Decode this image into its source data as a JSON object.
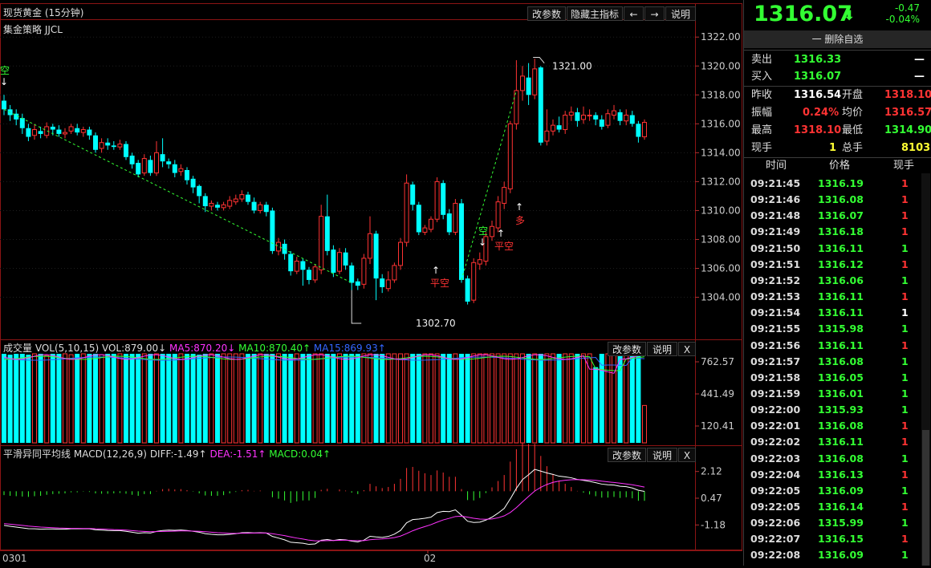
{
  "main_chart": {
    "title": "现货黄金 (15分钟)",
    "strategy": "集金策略 JJCL",
    "buttons": [
      "改参数",
      "隐藏主指标",
      "←",
      "→",
      "说明"
    ],
    "price_axis": [
      "1322.00",
      "1320.00",
      "1318.00",
      "1316.00",
      "1314.00",
      "1312.00",
      "1310.00",
      "1308.00",
      "1306.00",
      "1304.00"
    ],
    "high_label": "1321.00",
    "low_label": "1302.70",
    "signals": {
      "short1": "空",
      "short2": "空",
      "long": "多",
      "flat_short1": "平空",
      "flat_short2": "平空"
    },
    "colors": {
      "up": "#ff3333",
      "down": "#00ffff",
      "trend": "#33ff33",
      "grid": "#1e1e1e",
      "border": "#8b1414"
    }
  },
  "volume_panel": {
    "name": "成交量",
    "params": "VOL(5,10,15)",
    "vol": "VOL:879.00↓",
    "ma5": "MA5:870.20↓",
    "ma10": "MA10:870.40↑",
    "ma15": "MA15:869.93↑",
    "buttons": [
      "改参数",
      "说明",
      "X"
    ],
    "axis": [
      "762.57",
      "441.49",
      "120.41"
    ]
  },
  "macd_panel": {
    "name": "平滑异同平均线",
    "params": "MACD(12,26,9)",
    "diff": "DIFF:-1.49↑",
    "dea": "DEA:-1.51↑",
    "macd": "MACD:0.04↑",
    "buttons": [
      "改参数",
      "说明",
      "X"
    ],
    "axis": [
      "2.12",
      "0.47",
      "-1.18"
    ]
  },
  "date_axis": [
    "0301",
    "02"
  ],
  "quote": {
    "price": "1316.07",
    "change": "-0.47",
    "change_pct": "-0.04%",
    "remove_label": "一 删除自选",
    "sell_label": "卖出",
    "sell": "1316.33",
    "sell_qty": "—",
    "buy_label": "买入",
    "buy": "1316.07",
    "buy_qty": "—",
    "prev_close_label": "昨收",
    "prev_close": "1316.54",
    "open_label": "开盘",
    "open": "1318.10",
    "amplitude_label": "振幅",
    "amplitude": "0.24%",
    "avg_label": "均价",
    "avg": "1316.57",
    "high_label": "最高",
    "high": "1318.10",
    "low_label": "最低",
    "low": "1314.90",
    "cur_qty_label": "现手",
    "cur_qty": "1",
    "total_qty_label": "总手",
    "total_qty": "8103"
  },
  "ticks": {
    "headers": [
      "时间",
      "价格",
      "现手"
    ],
    "rows": [
      {
        "time": "09:21:45",
        "price": "1316.19",
        "qty": "1",
        "qty_color": "#ff3333"
      },
      {
        "time": "09:21:46",
        "price": "1316.08",
        "qty": "1",
        "qty_color": "#ff3333"
      },
      {
        "time": "09:21:48",
        "price": "1316.07",
        "qty": "1",
        "qty_color": "#ff3333"
      },
      {
        "time": "09:21:49",
        "price": "1316.18",
        "qty": "1",
        "qty_color": "#ff3333"
      },
      {
        "time": "09:21:50",
        "price": "1316.11",
        "qty": "1",
        "qty_color": "#33ff33"
      },
      {
        "time": "09:21:51",
        "price": "1316.12",
        "qty": "1",
        "qty_color": "#ff3333"
      },
      {
        "time": "09:21:52",
        "price": "1316.06",
        "qty": "1",
        "qty_color": "#33ff33"
      },
      {
        "time": "09:21:53",
        "price": "1316.11",
        "qty": "1",
        "qty_color": "#ff3333"
      },
      {
        "time": "09:21:54",
        "price": "1316.11",
        "qty": "1",
        "qty_color": "#ffffff"
      },
      {
        "time": "09:21:55",
        "price": "1315.98",
        "qty": "1",
        "qty_color": "#33ff33"
      },
      {
        "time": "09:21:56",
        "price": "1316.11",
        "qty": "1",
        "qty_color": "#ff3333"
      },
      {
        "time": "09:21:57",
        "price": "1316.08",
        "qty": "1",
        "qty_color": "#33ff33"
      },
      {
        "time": "09:21:58",
        "price": "1316.05",
        "qty": "1",
        "qty_color": "#33ff33"
      },
      {
        "time": "09:21:59",
        "price": "1316.01",
        "qty": "1",
        "qty_color": "#33ff33"
      },
      {
        "time": "09:22:00",
        "price": "1315.93",
        "qty": "1",
        "qty_color": "#33ff33"
      },
      {
        "time": "09:22:01",
        "price": "1316.08",
        "qty": "1",
        "qty_color": "#ff3333"
      },
      {
        "time": "09:22:02",
        "price": "1316.11",
        "qty": "1",
        "qty_color": "#ff3333"
      },
      {
        "time": "09:22:03",
        "price": "1316.08",
        "qty": "1",
        "qty_color": "#33ff33"
      },
      {
        "time": "09:22:04",
        "price": "1316.13",
        "qty": "1",
        "qty_color": "#ff3333"
      },
      {
        "time": "09:22:05",
        "price": "1316.09",
        "qty": "1",
        "qty_color": "#33ff33"
      },
      {
        "time": "09:22:05",
        "price": "1316.14",
        "qty": "1",
        "qty_color": "#ff3333"
      },
      {
        "time": "09:22:06",
        "price": "1315.99",
        "qty": "1",
        "qty_color": "#33ff33"
      },
      {
        "time": "09:22:07",
        "price": "1316.15",
        "qty": "1",
        "qty_color": "#ff3333"
      },
      {
        "time": "09:22:08",
        "price": "1316.09",
        "qty": "1",
        "qty_color": "#33ff33"
      }
    ]
  },
  "candles": [
    [
      1317.6,
      1317.0,
      1318.0,
      1316.6
    ],
    [
      1317.0,
      1316.6,
      1317.3,
      1316.2
    ],
    [
      1316.7,
      1316.3,
      1317.0,
      1315.9
    ],
    [
      1316.4,
      1315.7,
      1316.7,
      1315.3
    ],
    [
      1315.7,
      1315.1,
      1316.0,
      1314.8
    ],
    [
      1315.2,
      1315.6,
      1316.0,
      1314.9
    ],
    [
      1315.5,
      1315.3,
      1315.8,
      1315.0
    ],
    [
      1315.2,
      1315.8,
      1316.1,
      1315.0
    ],
    [
      1315.8,
      1315.6,
      1316.0,
      1315.2
    ],
    [
      1315.6,
      1315.3,
      1315.9,
      1315.1
    ],
    [
      1315.3,
      1315.4,
      1315.7,
      1315.0
    ],
    [
      1315.5,
      1315.8,
      1316.0,
      1315.3
    ],
    [
      1315.7,
      1315.4,
      1316.0,
      1315.2
    ],
    [
      1315.4,
      1315.6,
      1315.8,
      1315.1
    ],
    [
      1315.6,
      1315.2,
      1315.8,
      1314.9
    ],
    [
      1315.2,
      1314.2,
      1315.4,
      1314.0
    ],
    [
      1314.3,
      1314.7,
      1315.0,
      1314.0
    ],
    [
      1314.7,
      1314.5,
      1315.0,
      1314.2
    ],
    [
      1314.5,
      1314.4,
      1314.8,
      1314.2
    ],
    [
      1314.4,
      1314.6,
      1314.9,
      1314.2
    ],
    [
      1314.6,
      1313.7,
      1314.8,
      1313.5
    ],
    [
      1313.8,
      1313.2,
      1314.0,
      1312.9
    ],
    [
      1313.3,
      1312.5,
      1313.5,
      1312.3
    ],
    [
      1312.6,
      1313.6,
      1313.9,
      1312.4
    ],
    [
      1313.5,
      1312.6,
      1313.8,
      1312.4
    ],
    [
      1312.6,
      1314.0,
      1314.8,
      1312.4
    ],
    [
      1313.9,
      1313.4,
      1315.0,
      1313.0
    ],
    [
      1313.4,
      1313.2,
      1313.6,
      1312.9
    ],
    [
      1313.2,
      1312.6,
      1313.5,
      1312.3
    ],
    [
      1312.7,
      1312.9,
      1313.2,
      1312.4
    ],
    [
      1312.8,
      1312.1,
      1313.0,
      1311.8
    ],
    [
      1312.2,
      1311.6,
      1312.4,
      1311.2
    ],
    [
      1311.7,
      1311.0,
      1311.8,
      1310.5
    ],
    [
      1311.0,
      1310.3,
      1311.2,
      1309.9
    ],
    [
      1310.3,
      1310.5,
      1310.7,
      1310.0
    ],
    [
      1310.4,
      1310.2,
      1310.6,
      1310.0
    ],
    [
      1310.2,
      1310.4,
      1310.6,
      1310.0
    ],
    [
      1310.3,
      1310.7,
      1311.0,
      1310.1
    ],
    [
      1310.6,
      1310.8,
      1311.1,
      1310.4
    ],
    [
      1310.8,
      1311.1,
      1311.4,
      1310.6
    ],
    [
      1311.1,
      1310.6,
      1311.3,
      1310.4
    ],
    [
      1310.6,
      1310.0,
      1310.9,
      1309.8
    ],
    [
      1310.0,
      1310.4,
      1310.6,
      1309.8
    ],
    [
      1310.4,
      1309.9,
      1310.6,
      1309.6
    ],
    [
      1310.0,
      1307.2,
      1310.2,
      1307.0
    ],
    [
      1307.2,
      1307.8,
      1308.1,
      1306.9
    ],
    [
      1307.7,
      1307.0,
      1308.0,
      1306.6
    ],
    [
      1307.0,
      1305.8,
      1307.2,
      1305.5
    ],
    [
      1305.8,
      1306.5,
      1306.8,
      1305.6
    ],
    [
      1306.5,
      1305.9,
      1306.7,
      1304.8
    ],
    [
      1305.9,
      1305.2,
      1306.1,
      1304.9
    ],
    [
      1305.2,
      1306.1,
      1306.3,
      1305.0
    ],
    [
      1305.9,
      1309.6,
      1310.4,
      1305.6
    ],
    [
      1309.6,
      1307.2,
      1311.1,
      1306.9
    ],
    [
      1307.3,
      1305.7,
      1307.6,
      1305.4
    ],
    [
      1305.8,
      1307.1,
      1307.4,
      1305.6
    ],
    [
      1307.1,
      1306.2,
      1307.4,
      1305.9
    ],
    [
      1306.2,
      1305.0,
      1306.4,
      1304.5
    ],
    [
      1305.1,
      1304.8,
      1305.3,
      1304.5
    ],
    [
      1304.9,
      1306.7,
      1307.0,
      1304.6
    ],
    [
      1306.7,
      1308.4,
      1309.6,
      1306.3
    ],
    [
      1308.4,
      1305.3,
      1308.6,
      1303.8
    ],
    [
      1305.3,
      1304.7,
      1305.6,
      1304.3
    ],
    [
      1304.6,
      1305.2,
      1305.8,
      1304.4
    ],
    [
      1305.2,
      1306.2,
      1306.4,
      1305.0
    ],
    [
      1306.2,
      1307.8,
      1308.1,
      1305.9
    ],
    [
      1307.8,
      1311.9,
      1312.5,
      1307.5
    ],
    [
      1311.8,
      1310.4,
      1312.0,
      1310.0
    ],
    [
      1310.4,
      1308.5,
      1310.6,
      1308.3
    ],
    [
      1308.5,
      1308.8,
      1309.0,
      1308.3
    ],
    [
      1308.7,
      1309.4,
      1309.6,
      1308.5
    ],
    [
      1309.4,
      1312.0,
      1312.3,
      1309.2
    ],
    [
      1311.9,
      1309.7,
      1312.1,
      1309.4
    ],
    [
      1309.8,
      1308.5,
      1310.1,
      1308.3
    ],
    [
      1308.5,
      1310.5,
      1310.8,
      1308.3
    ],
    [
      1310.5,
      1305.2,
      1310.8,
      1305.0
    ],
    [
      1305.3,
      1303.7,
      1305.5,
      1303.5
    ],
    [
      1303.8,
      1306.4,
      1306.7,
      1303.6
    ],
    [
      1306.3,
      1306.6,
      1307.1,
      1305.9
    ],
    [
      1306.5,
      1308.2,
      1308.5,
      1306.2
    ],
    [
      1308.2,
      1308.9,
      1309.3,
      1307.9
    ],
    [
      1308.8,
      1310.6,
      1311.0,
      1308.5
    ],
    [
      1310.5,
      1311.6,
      1312.0,
      1310.1
    ],
    [
      1311.5,
      1316.0,
      1316.2,
      1311.2
    ],
    [
      1316.0,
      1318.3,
      1320.4,
      1315.6
    ],
    [
      1318.3,
      1319.3,
      1320.0,
      1317.6
    ],
    [
      1319.2,
      1318.0,
      1320.2,
      1317.3
    ],
    [
      1318.0,
      1319.8,
      1320.5,
      1317.7
    ],
    [
      1319.9,
      1314.7,
      1320.0,
      1314.5
    ],
    [
      1314.8,
      1315.5,
      1317.0,
      1314.5
    ],
    [
      1315.5,
      1315.9,
      1316.3,
      1315.2
    ],
    [
      1315.9,
      1315.6,
      1316.5,
      1315.4
    ],
    [
      1315.6,
      1316.6,
      1316.9,
      1315.3
    ],
    [
      1316.6,
      1316.8,
      1317.2,
      1316.2
    ],
    [
      1316.8,
      1316.2,
      1317.1,
      1315.8
    ],
    [
      1316.3,
      1316.6,
      1317.2,
      1316.0
    ],
    [
      1316.6,
      1316.6,
      1317.0,
      1316.2
    ],
    [
      1316.6,
      1316.3,
      1316.8,
      1315.9
    ],
    [
      1316.3,
      1315.8,
      1316.6,
      1315.6
    ],
    [
      1315.9,
      1316.7,
      1317.0,
      1315.7
    ],
    [
      1316.6,
      1316.9,
      1317.3,
      1316.3
    ],
    [
      1316.8,
      1316.2,
      1317.0,
      1315.9
    ],
    [
      1316.2,
      1316.6,
      1317.0,
      1315.9
    ],
    [
      1316.6,
      1316.0,
      1316.9,
      1315.8
    ],
    [
      1316.0,
      1315.1,
      1316.2,
      1314.7
    ],
    [
      1315.1,
      1316.1,
      1316.3,
      1314.9
    ]
  ],
  "volume_levels": [
    1,
    0.99,
    1,
    1,
    0.99,
    1,
    1,
    0.98,
    1,
    1,
    1,
    0.99,
    1,
    1,
    1,
    1,
    0.99,
    1,
    1,
    1,
    1,
    1,
    1,
    1,
    1,
    1,
    1,
    1,
    1,
    1,
    1,
    1,
    0.99,
    1,
    1,
    1,
    1,
    1,
    1,
    1,
    1,
    1,
    1,
    1,
    1,
    1,
    1,
    1,
    1,
    1,
    1,
    1,
    1,
    1,
    1,
    1,
    1,
    1,
    1,
    1,
    1,
    1,
    1,
    1,
    1,
    1,
    1,
    1,
    1,
    1,
    1,
    1,
    1,
    1,
    1,
    1,
    1,
    1,
    1,
    1,
    1,
    1,
    1,
    1,
    1,
    1,
    1,
    1,
    1,
    1,
    1,
    1,
    1,
    1,
    1,
    1,
    1,
    0.85,
    1,
    1,
    1,
    1,
    1,
    1,
    1,
    0.42
  ],
  "macd_series": {
    "diff": [
      -1.21,
      -1.26,
      -1.31,
      -1.36,
      -1.41,
      -1.42,
      -1.44,
      -1.43,
      -1.43,
      -1.44,
      -1.44,
      -1.42,
      -1.42,
      -1.41,
      -1.42,
      -1.48,
      -1.5,
      -1.52,
      -1.53,
      -1.53,
      -1.57,
      -1.63,
      -1.69,
      -1.66,
      -1.68,
      -1.58,
      -1.52,
      -1.5,
      -1.51,
      -1.49,
      -1.52,
      -1.57,
      -1.63,
      -1.72,
      -1.76,
      -1.79,
      -1.79,
      -1.76,
      -1.72,
      -1.66,
      -1.65,
      -1.67,
      -1.66,
      -1.68,
      -1.89,
      -1.99,
      -2.1,
      -2.25,
      -2.28,
      -2.31,
      -2.38,
      -2.35,
      -2.12,
      -2.08,
      -2.14,
      -2.08,
      -2.1,
      -2.18,
      -2.23,
      -2.12,
      -1.88,
      -1.92,
      -1.95,
      -1.89,
      -1.75,
      -1.52,
      -1.05,
      -0.85,
      -0.82,
      -0.77,
      -0.7,
      -0.42,
      -0.34,
      -0.36,
      -0.25,
      -0.58,
      -0.95,
      -1.03,
      -1.01,
      -0.88,
      -0.7,
      -0.45,
      -0.16,
      0.43,
      1.08,
      1.62,
      1.92,
      2.25,
      2.14,
      2.03,
      1.94,
      1.83,
      1.79,
      1.73,
      1.63,
      1.57,
      1.51,
      1.43,
      1.34,
      1.3,
      1.28,
      1.21,
      1.18,
      1.1,
      0.96,
      0.89
    ],
    "dea": [
      -1.1,
      -1.13,
      -1.17,
      -1.21,
      -1.25,
      -1.28,
      -1.31,
      -1.33,
      -1.35,
      -1.37,
      -1.38,
      -1.39,
      -1.39,
      -1.4,
      -1.4,
      -1.42,
      -1.43,
      -1.45,
      -1.47,
      -1.48,
      -1.5,
      -1.53,
      -1.56,
      -1.58,
      -1.6,
      -1.59,
      -1.58,
      -1.57,
      -1.56,
      -1.55,
      -1.55,
      -1.56,
      -1.57,
      -1.6,
      -1.63,
      -1.66,
      -1.68,
      -1.7,
      -1.7,
      -1.69,
      -1.69,
      -1.68,
      -1.68,
      -1.68,
      -1.72,
      -1.78,
      -1.84,
      -1.92,
      -1.99,
      -2.05,
      -2.12,
      -2.16,
      -2.16,
      -2.15,
      -2.14,
      -2.13,
      -2.12,
      -2.14,
      -2.15,
      -2.15,
      -2.09,
      -2.06,
      -2.04,
      -2.01,
      -1.96,
      -1.87,
      -1.71,
      -1.54,
      -1.4,
      -1.28,
      -1.16,
      -1.01,
      -0.87,
      -0.77,
      -0.66,
      -0.64,
      -0.7,
      -0.77,
      -0.82,
      -0.83,
      -0.81,
      -0.74,
      -0.62,
      -0.41,
      -0.11,
      0.24,
      0.58,
      0.91,
      1.14,
      1.32,
      1.45,
      1.53,
      1.58,
      1.61,
      1.62,
      1.61,
      1.6,
      1.57,
      1.52,
      1.48,
      1.44,
      1.4,
      1.35,
      1.3,
      1.23,
      1.16
    ]
  }
}
